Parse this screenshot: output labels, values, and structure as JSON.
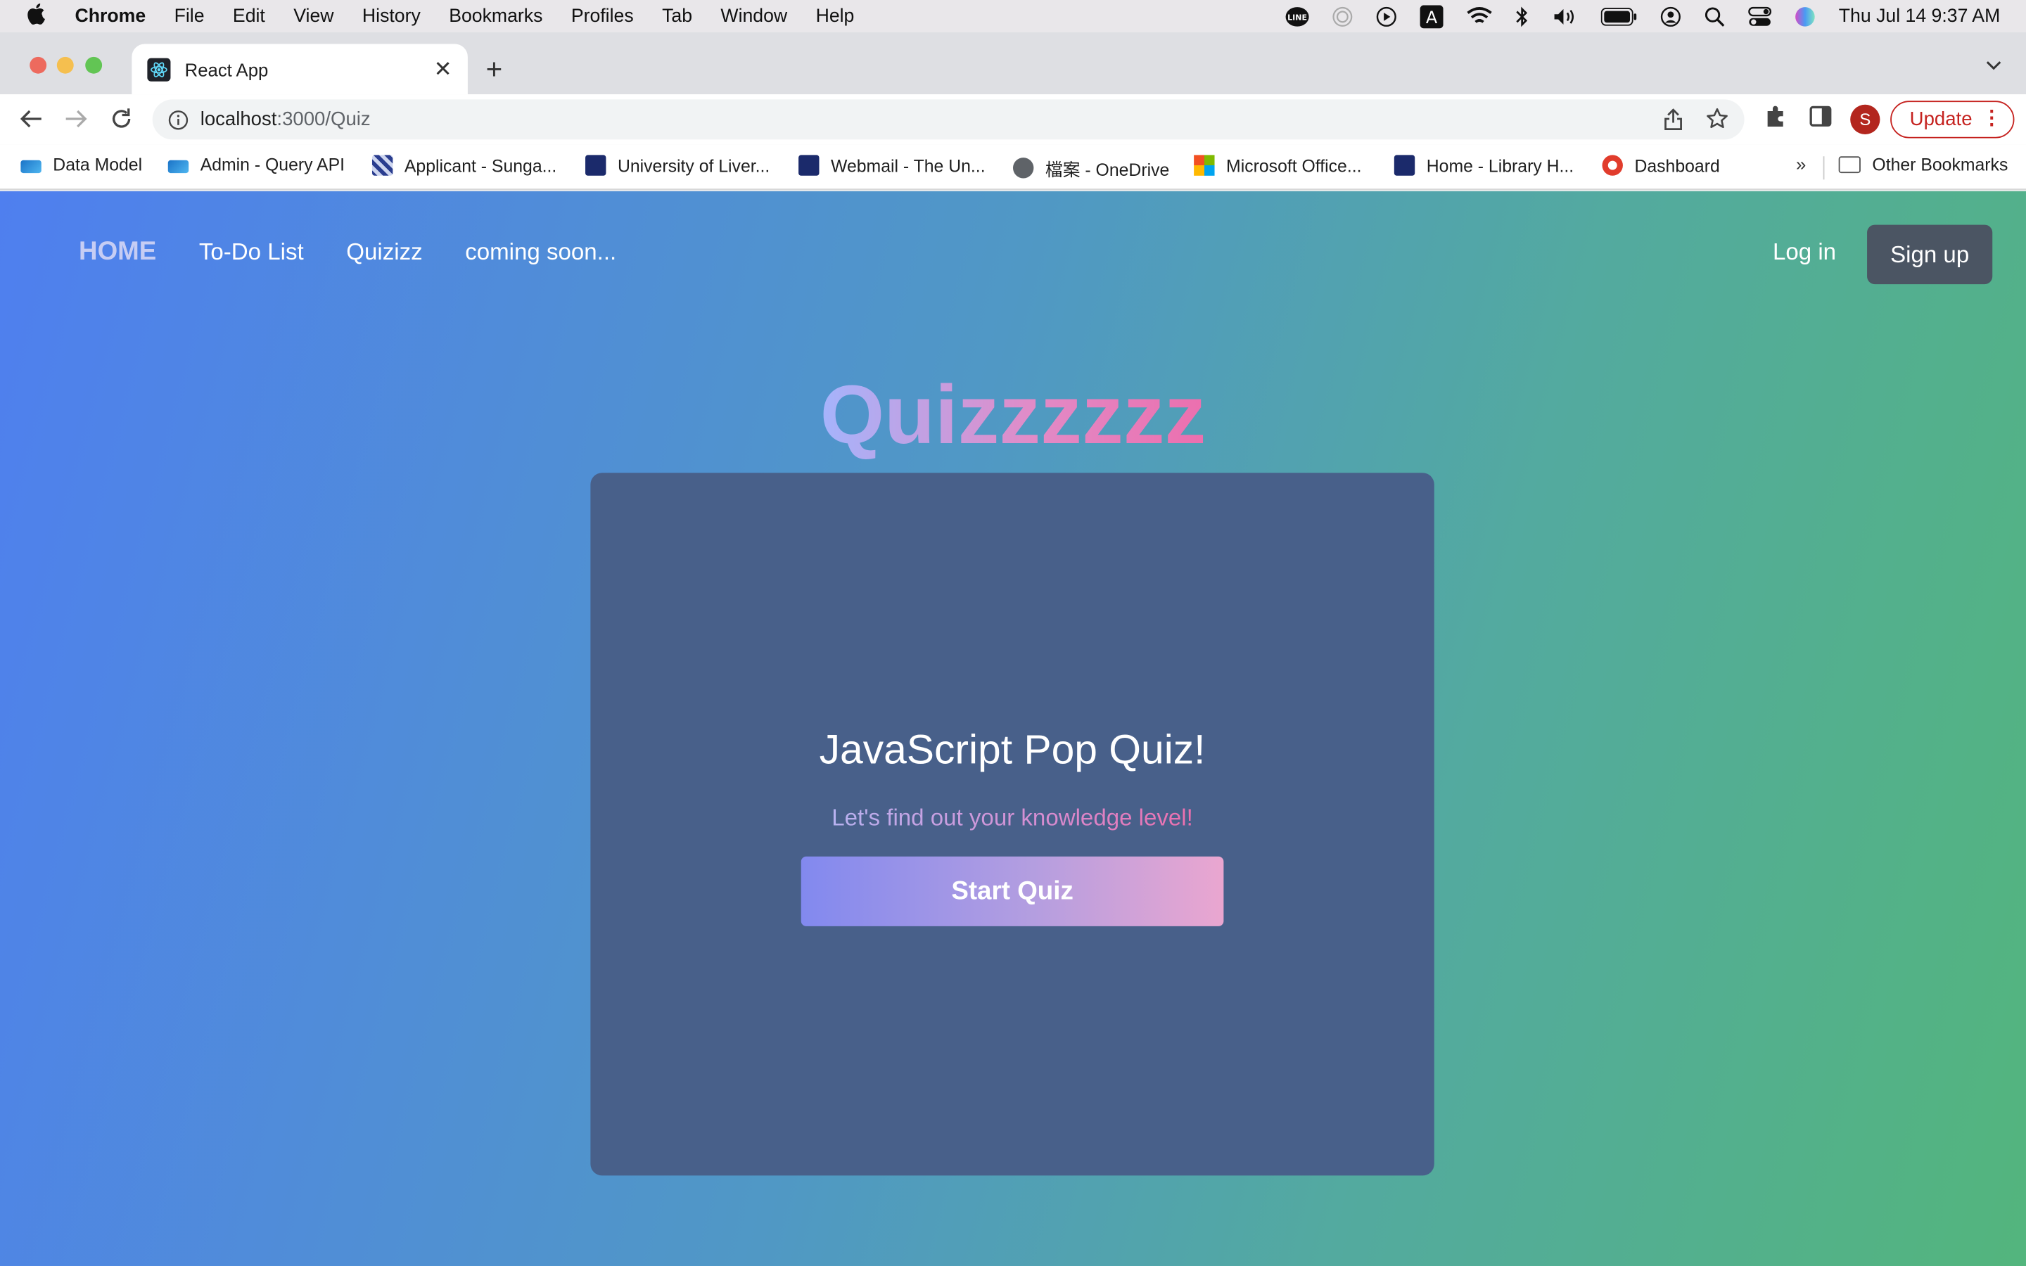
{
  "menubar": {
    "app_name": "Chrome",
    "items": [
      "File",
      "Edit",
      "View",
      "History",
      "Bookmarks",
      "Profiles",
      "Tab",
      "Window",
      "Help"
    ],
    "clock": "Thu Jul 14  9:37 AM",
    "status_icons": [
      "line-icon",
      "airdrop-icon",
      "play-icon",
      "input-source-icon",
      "wifi-icon",
      "bluetooth-icon",
      "volume-icon",
      "battery-icon",
      "user-icon",
      "spotlight-icon",
      "control-center-icon",
      "siri-icon"
    ],
    "input_source_label": "A"
  },
  "browser": {
    "tab_title": "React App",
    "url_host": "localhost",
    "url_path": ":3000/Quiz",
    "profile_initial": "S",
    "update_label": "Update",
    "bookmarks": [
      {
        "label": "Data Model",
        "icon": "sap-icon"
      },
      {
        "label": "Admin - Query API",
        "icon": "sap-icon"
      },
      {
        "label": "Applicant - Sunga...",
        "icon": "applicant-icon"
      },
      {
        "label": "University of Liver...",
        "icon": "uol-icon"
      },
      {
        "label": "Webmail - The Un...",
        "icon": "uol-icon"
      },
      {
        "label": "檔案 - OneDrive",
        "icon": "globe-icon"
      },
      {
        "label": "Microsoft Office...",
        "icon": "microsoft-icon"
      },
      {
        "label": "Home - Library H...",
        "icon": "uol-icon"
      },
      {
        "label": "Dashboard",
        "icon": "canvas-icon"
      }
    ],
    "more_bookmarks": "»",
    "other_bookmarks": "Other Bookmarks"
  },
  "app": {
    "nav": {
      "home": "HOME",
      "todo": "To-Do List",
      "quiz": "Quizizz",
      "soon": "coming soon...",
      "login": "Log in",
      "signup": "Sign up"
    },
    "title": "Quizzzzzz",
    "card": {
      "heading": "JavaScript Pop Quiz!",
      "subtitle": "Let's find out your knowledge level!",
      "start_button": "Start Quiz"
    }
  },
  "colors": {
    "page_gradient_start": "#4f7fef",
    "page_gradient_end": "#53b57d",
    "card_bg": "#48608a",
    "signup_bg": "#4b5563",
    "update_red": "#c5221f"
  }
}
